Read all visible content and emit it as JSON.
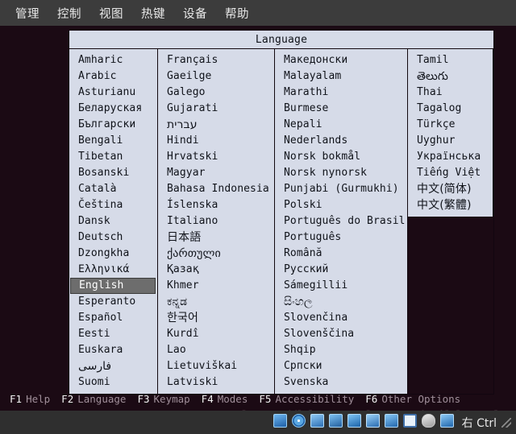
{
  "window": {
    "menubar": [
      {
        "label": "管理",
        "name": "menu-manage"
      },
      {
        "label": "控制",
        "name": "menu-control"
      },
      {
        "label": "视图",
        "name": "menu-view"
      },
      {
        "label": "热键",
        "name": "menu-hotkey"
      },
      {
        "label": "设备",
        "name": "menu-device"
      },
      {
        "label": "帮助",
        "name": "menu-help"
      }
    ]
  },
  "dialog": {
    "title": "Language",
    "columns": [
      {
        "items": [
          {
            "label": "Amharic",
            "selected": false
          },
          {
            "label": "Arabic",
            "selected": false
          },
          {
            "label": "Asturianu",
            "selected": false
          },
          {
            "label": "Беларуская",
            "selected": false
          },
          {
            "label": "Български",
            "selected": false
          },
          {
            "label": "Bengali",
            "selected": false
          },
          {
            "label": "Tibetan",
            "selected": false
          },
          {
            "label": "Bosanski",
            "selected": false
          },
          {
            "label": "Català",
            "selected": false
          },
          {
            "label": "Čeština",
            "selected": false
          },
          {
            "label": "Dansk",
            "selected": false
          },
          {
            "label": "Deutsch",
            "selected": false
          },
          {
            "label": "Dzongkha",
            "selected": false
          },
          {
            "label": "Ελληνικά",
            "selected": false
          },
          {
            "label": "English",
            "selected": true
          },
          {
            "label": "Esperanto",
            "selected": false
          },
          {
            "label": "Español",
            "selected": false
          },
          {
            "label": "Eesti",
            "selected": false
          },
          {
            "label": "Euskara",
            "selected": false
          },
          {
            "label": "فارسی",
            "selected": false
          },
          {
            "label": "Suomi",
            "selected": false
          }
        ]
      },
      {
        "items": [
          {
            "label": "Français",
            "selected": false
          },
          {
            "label": "Gaeilge",
            "selected": false
          },
          {
            "label": "Galego",
            "selected": false
          },
          {
            "label": "Gujarati",
            "selected": false
          },
          {
            "label": "עברית",
            "selected": false
          },
          {
            "label": "Hindi",
            "selected": false
          },
          {
            "label": "Hrvatski",
            "selected": false
          },
          {
            "label": "Magyar",
            "selected": false
          },
          {
            "label": "Bahasa Indonesia",
            "selected": false
          },
          {
            "label": "Íslenska",
            "selected": false
          },
          {
            "label": "Italiano",
            "selected": false
          },
          {
            "label": "日本語",
            "selected": false
          },
          {
            "label": "ქართული",
            "selected": false
          },
          {
            "label": "Қазақ",
            "selected": false
          },
          {
            "label": "Khmer",
            "selected": false
          },
          {
            "label": "ಕನ್ನಡ",
            "selected": false
          },
          {
            "label": "한국어",
            "selected": false
          },
          {
            "label": "Kurdî",
            "selected": false
          },
          {
            "label": "Lao",
            "selected": false
          },
          {
            "label": "Lietuviškai",
            "selected": false
          },
          {
            "label": "Latviski",
            "selected": false
          }
        ]
      },
      {
        "items": [
          {
            "label": "Македонски",
            "selected": false
          },
          {
            "label": "Malayalam",
            "selected": false
          },
          {
            "label": "Marathi",
            "selected": false
          },
          {
            "label": "Burmese",
            "selected": false
          },
          {
            "label": "Nepali",
            "selected": false
          },
          {
            "label": "Nederlands",
            "selected": false
          },
          {
            "label": "Norsk bokmål",
            "selected": false
          },
          {
            "label": "Norsk nynorsk",
            "selected": false
          },
          {
            "label": "Punjabi (Gurmukhi)",
            "selected": false
          },
          {
            "label": "Polski",
            "selected": false
          },
          {
            "label": "Português do Brasil",
            "selected": false
          },
          {
            "label": "Português",
            "selected": false
          },
          {
            "label": "Română",
            "selected": false
          },
          {
            "label": "Русский",
            "selected": false
          },
          {
            "label": "Sámegillii",
            "selected": false
          },
          {
            "label": "සිංහල",
            "selected": false
          },
          {
            "label": "Slovenčina",
            "selected": false
          },
          {
            "label": "Slovenščina",
            "selected": false
          },
          {
            "label": "Shqip",
            "selected": false
          },
          {
            "label": "Српски",
            "selected": false
          },
          {
            "label": "Svenska",
            "selected": false
          }
        ]
      },
      {
        "items": [
          {
            "label": "Tamil",
            "selected": false
          },
          {
            "label": "తెలుగు",
            "selected": false
          },
          {
            "label": "Thai",
            "selected": false
          },
          {
            "label": "Tagalog",
            "selected": false
          },
          {
            "label": "Türkçe",
            "selected": false
          },
          {
            "label": "Uyghur",
            "selected": false
          },
          {
            "label": "Українська",
            "selected": false
          },
          {
            "label": "Tiếng Việt",
            "selected": false
          },
          {
            "label": "中文(简体)",
            "selected": false
          },
          {
            "label": "中文(繁體)",
            "selected": false
          }
        ]
      }
    ]
  },
  "function_keys": [
    {
      "key": "F1",
      "desc": "Help"
    },
    {
      "key": "F2",
      "desc": "Language"
    },
    {
      "key": "F3",
      "desc": "Keymap"
    },
    {
      "key": "F4",
      "desc": "Modes"
    },
    {
      "key": "F5",
      "desc": "Accessibility"
    },
    {
      "key": "F6",
      "desc": "Other Options"
    }
  ],
  "statusbar": {
    "icons": [
      {
        "name": "hard-disk-icon",
        "cls": "ic-hdd"
      },
      {
        "name": "cd-dvd-icon",
        "cls": "ic-cd"
      },
      {
        "name": "network-icon",
        "cls": "ic-net"
      },
      {
        "name": "usb-icon",
        "cls": "ic-usb"
      },
      {
        "name": "shared-folder-icon",
        "cls": "ic-fold"
      },
      {
        "name": "display-icon",
        "cls": "ic-disp"
      },
      {
        "name": "clipboard-icon",
        "cls": "ic-copy"
      },
      {
        "name": "cpu-icon",
        "cls": "ic-cpu"
      },
      {
        "name": "mouse-icon",
        "cls": "ic-mouse"
      },
      {
        "name": "drag-drop-icon",
        "cls": "ic-down"
      }
    ],
    "host_key": "右 Ctrl"
  },
  "watermark": {
    "text": "http://blog.csdn.net/wildestdream"
  }
}
